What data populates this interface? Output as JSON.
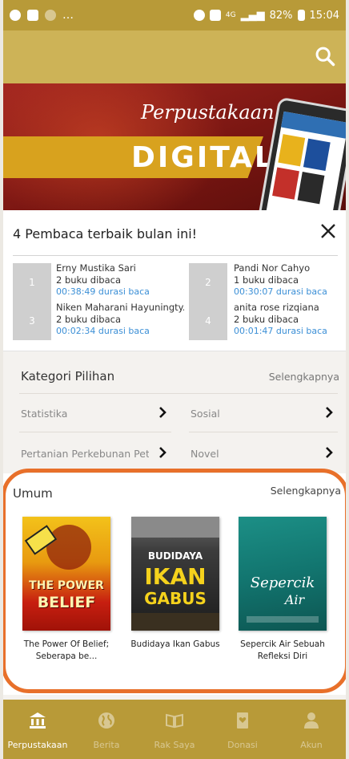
{
  "status_bar": {
    "battery": "82%",
    "time": "15:04",
    "network": "4G"
  },
  "banner": {
    "script_text": "Perpustakaan",
    "ribbon_text": "DIGITAL"
  },
  "top_readers": {
    "title": "4 Pembaca terbaik bulan ini!",
    "readers": [
      {
        "rank": "1",
        "name": "Erny Mustika Sari",
        "books": "2 buku dibaca",
        "duration": "00:38:49 durasi baca"
      },
      {
        "rank": "2",
        "name": "Pandi Nor Cahyo",
        "books": "1 buku dibaca",
        "duration": "00:30:07 durasi baca"
      },
      {
        "rank": "3",
        "name": "Niken Maharani Hayuningty...",
        "books": "2 buku dibaca",
        "duration": "00:02:34 durasi baca"
      },
      {
        "rank": "4",
        "name": "anita rose rizqiana",
        "books": "2 buku dibaca",
        "duration": "00:01:47 durasi baca"
      }
    ]
  },
  "kategori": {
    "title": "Kategori Pilihan",
    "more": "Selengkapnya",
    "items": [
      "Statistika",
      "Sosial",
      "Pertanian Perkebunan Pete...",
      "Novel"
    ]
  },
  "umum": {
    "title": "Umum",
    "more": "Selengkapnya",
    "books": [
      {
        "caption": "The Power Of Belief; Seberapa be...",
        "cover_line1": "THE POWER",
        "cover_line2": "BELIEF"
      },
      {
        "caption": "Budidaya Ikan Gabus",
        "cover_line1": "BUDIDAYA",
        "cover_line2": "IKAN",
        "cover_line3": "GABUS"
      },
      {
        "caption": "Sepercik Air Sebuah Refleksi Diri",
        "cover_line1": "Sepercik",
        "cover_line2": "Air"
      }
    ]
  },
  "bottom_nav": {
    "items": [
      "Perpustakaan",
      "Berita",
      "Rak Saya",
      "Donasi",
      "Akun"
    ],
    "active": "Perpustakaan"
  },
  "colors": {
    "accent": "#b89a38",
    "appbar": "#cdb357",
    "highlight": "#e8702a",
    "link": "#3b8fd6"
  }
}
